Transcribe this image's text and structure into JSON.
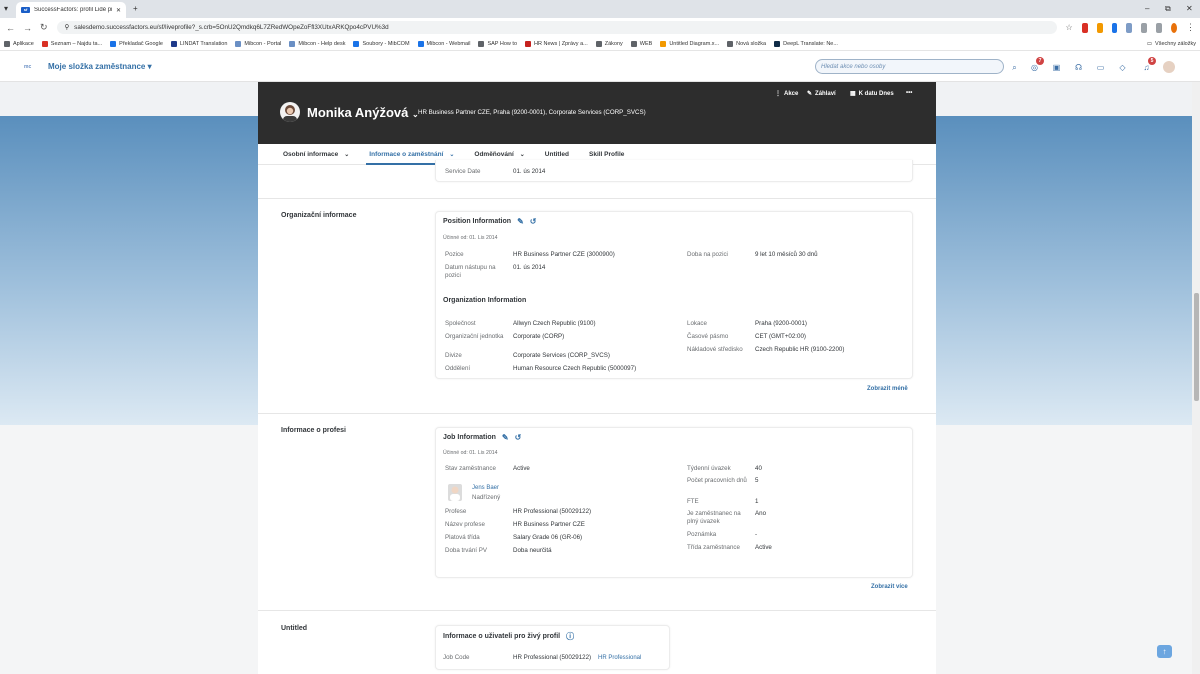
{
  "browser": {
    "tab_title": "SuccessFactors: profil Lidé pro",
    "url": "salesdemo.successfactors.eu/sf/liveprofile?_s.crb=5OnU2Qmdkq6L7ZRedWOpeZoFfl3XUtxARKQpo4cPVU%3d",
    "bookmarks": [
      "Aplikace",
      "Seznam – Najdu ta...",
      "Překladač Google",
      "LINDAT Translation",
      "Mibcon - Portal",
      "Mibcon - Help desk",
      "Soubory - MibCOM",
      "Mibcon - Webmail",
      "SAP How to",
      "HR News | Zprávy a...",
      "Zákony",
      "WEB",
      "Untitled Diagram.x...",
      "Nová složka",
      "DeepL Translate: Ne..."
    ],
    "all_bookmarks": "Všechny záložky"
  },
  "sf_header": {
    "logo": "mc",
    "module": "Moje složka zaměstnance",
    "search_placeholder": "Hledat akce nebo osoby",
    "badge_a": "7",
    "badge_b": "5"
  },
  "profile": {
    "name": "Monika Anýžová",
    "title": "HR Business Partner CZE, Praha (9200-0001), Corporate Services (CORP_SVCS)",
    "actions": [
      "Akce",
      "Záhlaví",
      "K datu Dnes",
      "•••"
    ]
  },
  "tabs": [
    "Osobní informace",
    "Informace o zaměstnání",
    "Odměňování",
    "Untitled",
    "Skill Profile"
  ],
  "service": {
    "label": "Service Date",
    "value": "01. ús 2014"
  },
  "org": {
    "section_title": "Organizační informace",
    "position_card_title": "Position Information",
    "effective": "Účinné od: 01. Lis 2014",
    "position_rows": [
      {
        "label": "Pozice",
        "value": "HR Business Partner CZE (3000900)"
      },
      {
        "label": "Datum nástupu na pozici",
        "value": "01. ús 2014"
      }
    ],
    "position_right": [
      {
        "label": "Doba na pozici",
        "value": "9 let 10 měsíců 30 dnů"
      }
    ],
    "org_subtitle": "Organization Information",
    "org_left": [
      {
        "label": "Společnost",
        "value": "Allwyn Czech Republic (9100)"
      },
      {
        "label": "Organizační jednotka",
        "value": "Corporate (CORP)"
      },
      {
        "label": "Divize",
        "value": "Corporate Services (CORP_SVCS)"
      },
      {
        "label": "Oddělení",
        "value": "Human Resource Czech Republic (5000097)"
      }
    ],
    "org_right": [
      {
        "label": "Lokace",
        "value": "Praha (9200-0001)"
      },
      {
        "label": "Časové pásmo",
        "value": "CET (GMT+02:00)"
      },
      {
        "label": "Nákladové středisko",
        "value": "Czech Republic HR (9100-2200)"
      }
    ],
    "show_less": "Zobrazit méně"
  },
  "job": {
    "section_title": "Informace o profesi",
    "card_title": "Job Information",
    "effective": "Účinné od: 01. Lis 2014",
    "status_label": "Stav zaměstnance",
    "status_value": "Active",
    "manager_name": "Jens Baer",
    "manager_role": "Nadřízený",
    "left_rows": [
      {
        "label": "Profese",
        "value": "HR Professional (50029122)"
      },
      {
        "label": "Název profese",
        "value": "HR Business Partner CZE"
      },
      {
        "label": "Platová třída",
        "value": "Salary Grade 06 (GR-06)"
      },
      {
        "label": "Doba trvání PV",
        "value": "Doba neurčitá"
      }
    ],
    "right_rows": [
      {
        "label": "Týdenní úvazek",
        "value": "40"
      },
      {
        "label": "Počet pracovních dnů",
        "value": "5"
      },
      {
        "label": "FTE",
        "value": "1"
      },
      {
        "label": "Je zaměstnanec na plný úvazek",
        "value": "Ano"
      },
      {
        "label": "Poznámka",
        "value": "-"
      },
      {
        "label": "Třída zaměstnance",
        "value": "Active"
      }
    ],
    "show_more": "Zobrazit více"
  },
  "untitled": {
    "section_title": "Untitled",
    "card_title": "Informace o uživateli pro živý profil",
    "row_label": "Job Code",
    "row_value": "HR Professional (50029122)",
    "row_link": "HR Professional"
  }
}
